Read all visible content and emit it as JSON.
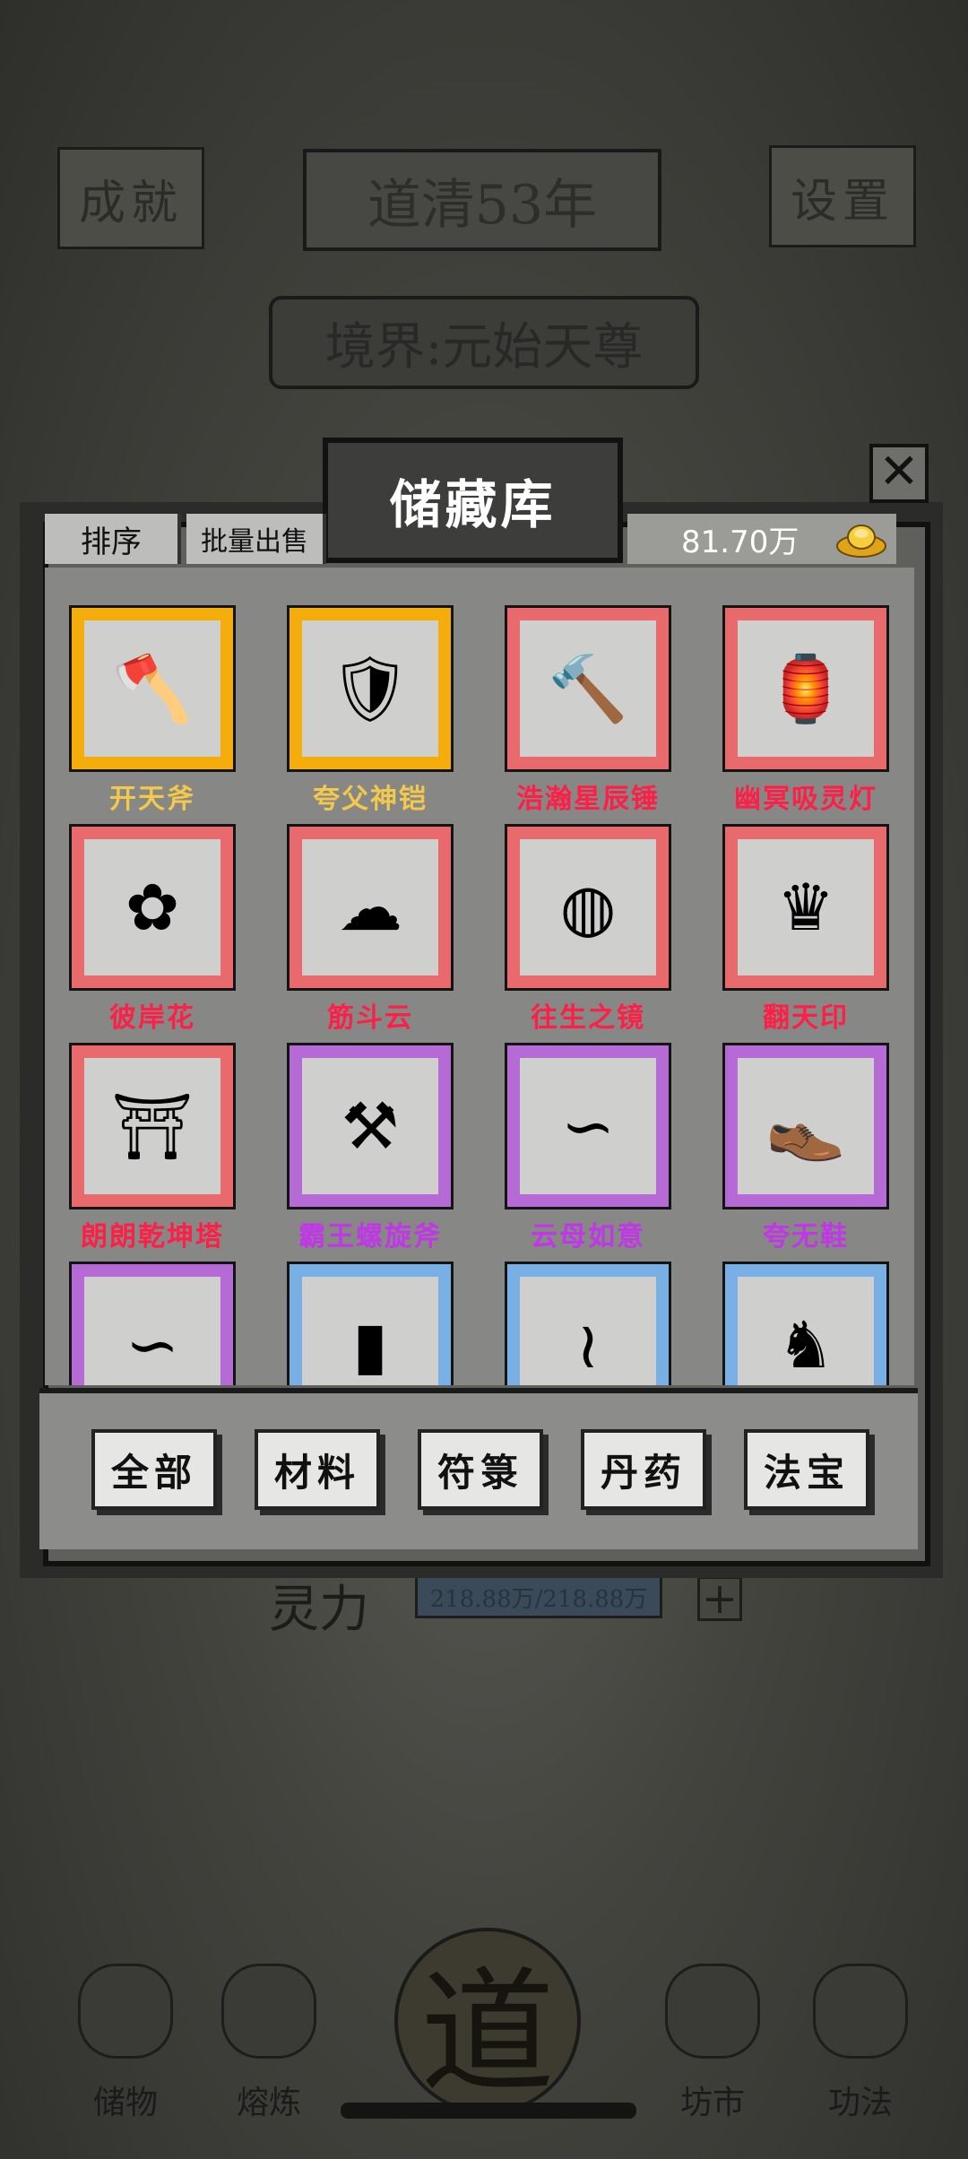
{
  "background": {
    "achievements_label": "成就",
    "year_label": "道清53年",
    "settings_label": "设置",
    "realm_label": "境界:元始天尊",
    "lingli_label": "灵力",
    "lingli_value": "218.88万/218.88万",
    "lingli_plus": "+"
  },
  "dialog": {
    "title": "储藏库",
    "close": "✕",
    "sort_label": "排序",
    "batch_sell_label": "批量出售",
    "currency_value": "81.70万",
    "currency_icon": "gold-ingot-icon"
  },
  "colors": {
    "gold_frame": "#f5ad0c",
    "red_frame": "#e86a6c",
    "purple_frame": "#b56ad6",
    "blue_frame": "#78b0e6",
    "gold_text": "#f2c94c",
    "red_text": "#ff1e46",
    "purple_text": "#c036e8"
  },
  "items": [
    {
      "name": "开天斧",
      "rarity": "gold",
      "icon": "axe-icon"
    },
    {
      "name": "夸父神铠",
      "rarity": "gold",
      "icon": "armor-icon"
    },
    {
      "name": "浩瀚星辰锤",
      "rarity": "red",
      "icon": "hammer-icon"
    },
    {
      "name": "幽冥吸灵灯",
      "rarity": "red",
      "icon": "lantern-icon"
    },
    {
      "name": "彼岸花",
      "rarity": "red",
      "icon": "spider-lily-icon"
    },
    {
      "name": "筋斗云",
      "rarity": "red",
      "icon": "cloud-icon"
    },
    {
      "name": "往生之镜",
      "rarity": "red",
      "icon": "mirror-icon"
    },
    {
      "name": "翻天印",
      "rarity": "red",
      "icon": "seal-icon"
    },
    {
      "name": "朗朗乾坤塔",
      "rarity": "red",
      "icon": "pagoda-icon"
    },
    {
      "name": "霸王螺旋斧",
      "rarity": "purple",
      "icon": "battle-axe-icon"
    },
    {
      "name": "云母如意",
      "rarity": "purple",
      "icon": "ruyi-icon"
    },
    {
      "name": "夸无鞋",
      "rarity": "purple",
      "icon": "shoe-icon"
    },
    {
      "name": "",
      "rarity": "purple",
      "icon": "ruyi-icon"
    },
    {
      "name": "",
      "rarity": "blue",
      "icon": "shield-icon"
    },
    {
      "name": "",
      "rarity": "blue",
      "icon": "scroll-icon"
    },
    {
      "name": "",
      "rarity": "blue",
      "icon": "beast-icon"
    }
  ],
  "categories": [
    "全部",
    "材料",
    "符箓",
    "丹药",
    "法宝"
  ],
  "bottom_nav": [
    {
      "label": "储物",
      "icon": "bag-icon"
    },
    {
      "label": "熔炼",
      "icon": "furnace-icon"
    },
    {
      "label": "道",
      "icon": "dao-emblem-icon"
    },
    {
      "label": "坊市",
      "icon": "coins-icon"
    },
    {
      "label": "功法",
      "icon": "book-icon"
    }
  ]
}
